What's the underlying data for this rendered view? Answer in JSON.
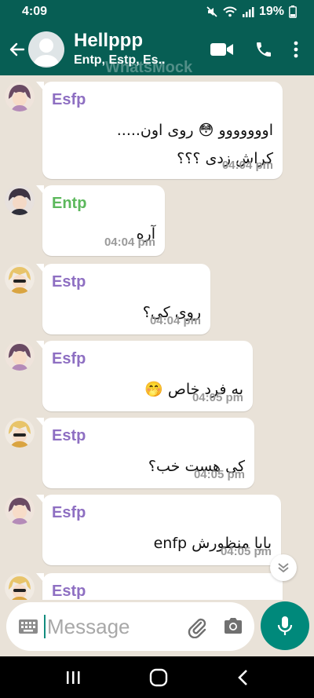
{
  "status_bar": {
    "time": "4:09",
    "battery": "19%"
  },
  "header": {
    "title": "Hellppp",
    "subtitle": "Entp, Estp, Es..",
    "watermark": "WhatsMock"
  },
  "colors": {
    "header": "#075e54",
    "esfp": "#8e6fc2",
    "entp": "#5cb85c",
    "estp": "#8e6fc2",
    "accent": "#00897b"
  },
  "messages": [
    {
      "sender": "Esfp",
      "lines": [
        "اووووووو 😳 روی اون.....",
        "کراش زدی ؟؟؟"
      ],
      "time": "04:04 pm"
    },
    {
      "sender": "Entp",
      "lines": [
        "آره"
      ],
      "time": "04:04 pm"
    },
    {
      "sender": "Estp",
      "lines": [
        "روی کی؟"
      ],
      "time": "04:04 pm"
    },
    {
      "sender": "Esfp",
      "lines": [
        "به فرد خاص 🤭"
      ],
      "time": "04:05 pm"
    },
    {
      "sender": "Estp",
      "lines": [
        "کی هست خب؟"
      ],
      "time": "04:05 pm"
    },
    {
      "sender": "Esfp",
      "lines": [
        "بابا منظورش enfp"
      ],
      "time": "04:05 pm"
    },
    {
      "sender": "Estp",
      "lines": [],
      "time": ""
    }
  ],
  "input": {
    "placeholder": "Message"
  },
  "icons": {
    "back": "arrow-left-icon",
    "video": "video-call-icon",
    "call": "phone-icon",
    "menu": "more-vertical-icon",
    "keyboard": "keyboard-icon",
    "attach": "paperclip-icon",
    "camera": "camera-icon",
    "mic": "mic-icon"
  }
}
